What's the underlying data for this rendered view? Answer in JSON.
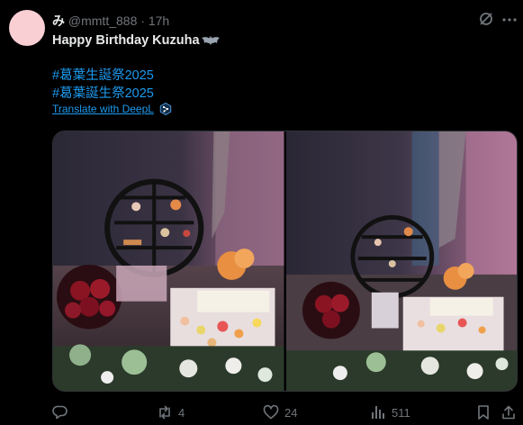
{
  "tweet": {
    "display_name": "み",
    "handle": "@mmtt_888",
    "separator": "·",
    "time": "17h",
    "text_line1": "Happy Birthday  Kuzuha",
    "hashtag1": "#葛葉生誕祭2025",
    "hashtag2": "#葛葉誕生祭2025",
    "translate_label": "Translate with DeepL"
  },
  "actions": {
    "retweets": "4",
    "likes": "24",
    "views": "511"
  },
  "colors": {
    "accent": "#1d9bf0",
    "muted": "#71767b",
    "avatar": "#f9cfd3"
  },
  "icons": [
    "grok-icon",
    "more-icon",
    "bat-icon",
    "deepl-icon",
    "reply-icon",
    "retweet-icon",
    "like-icon",
    "views-icon",
    "bookmark-icon",
    "share-icon"
  ]
}
